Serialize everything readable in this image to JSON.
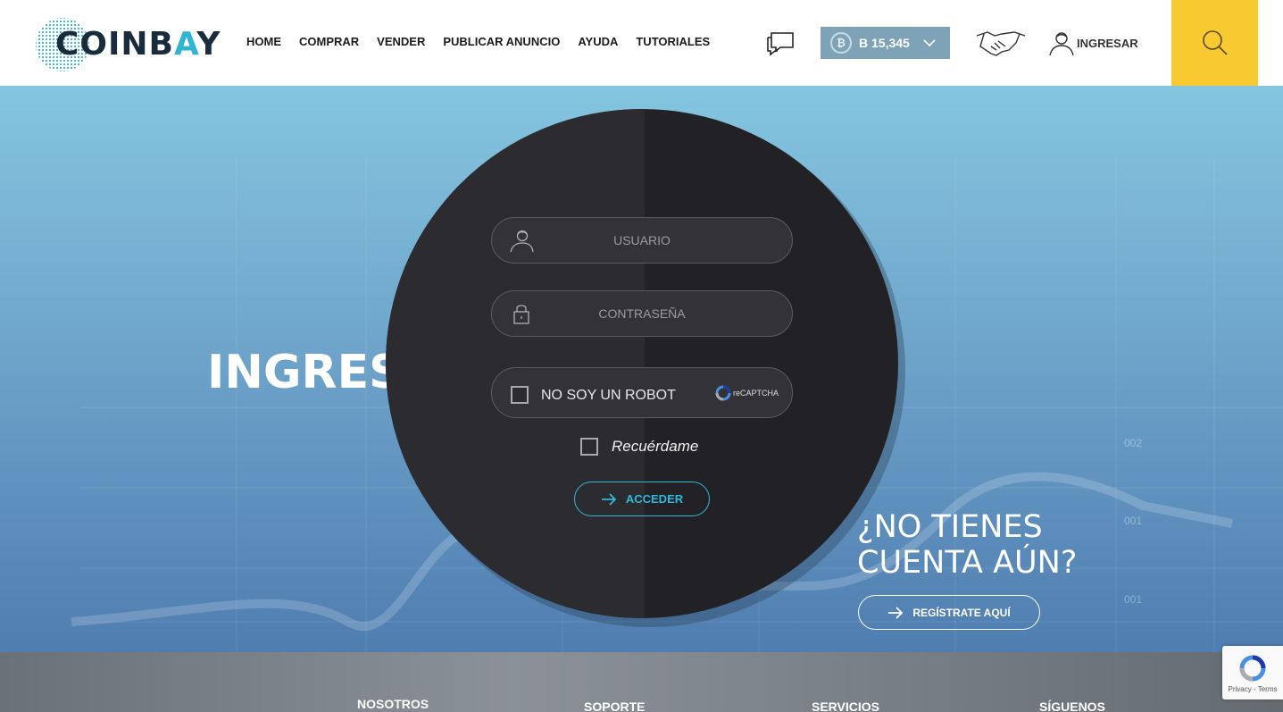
{
  "header": {
    "logo_text_a": "COINB",
    "logo_text_b": "A",
    "logo_text_c": "Y",
    "nav": [
      "HOME",
      "COMPRAR",
      "VENDER",
      "PUBLICAR ANUNCIO",
      "AYUDA",
      "TUTORIALES"
    ],
    "btc_symbol": "₿",
    "btc_balance": "B 15,345",
    "login_label": "INGRESAR",
    "icons": {
      "chat": "chat-bubbles-icon",
      "coin": "bitcoin-coin-icon",
      "dropdown": "chevron-down-icon",
      "trade": "handshake-icon",
      "user": "user-icon",
      "search": "search-icon"
    }
  },
  "hero": {
    "title": "INGRESAR",
    "username_placeholder": "USUARIO",
    "password_placeholder": "CONTRASEÑA",
    "captcha_label": "NO SOY UN ROBOT",
    "captcha_brand": "reCAPTCHA",
    "remember_label": "Recuérdame",
    "submit_label": "ACCEDER",
    "no_account_line1": "¿NO TIENES",
    "no_account_line2": "CUENTA AÚN?",
    "register_label": "REGÍSTRATE AQUÍ",
    "chart_ticks": [
      "002",
      "001",
      "001"
    ]
  },
  "footer": {
    "columns": [
      "NOSOTROS",
      "SOPORTE",
      "SERVICIOS",
      "SÍGUENOS"
    ]
  },
  "recaptcha_badge": {
    "text": "Privacy - Terms"
  },
  "colors": {
    "accent_yellow": "#f9c932",
    "accent_cyan": "#2fb8d8",
    "circle_dark": "#222226",
    "btc_box": "#7fa3b6"
  }
}
